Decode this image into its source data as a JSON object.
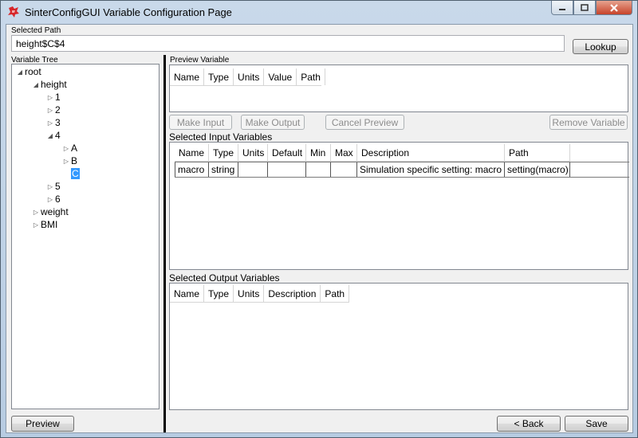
{
  "window": {
    "title": "SinterConfigGUI Variable Configuration Page"
  },
  "selected_path": {
    "label": "Selected Path",
    "value": "height$C$4",
    "lookup_label": "Lookup"
  },
  "tree": {
    "label": "Variable Tree",
    "nodes": [
      "root",
      "height",
      "1",
      "2",
      "3",
      "4",
      "A",
      "B",
      "C",
      "5",
      "6",
      "weight",
      "BMI"
    ]
  },
  "preview": {
    "label": "Preview Variable",
    "columns": [
      "Name",
      "Type",
      "Units",
      "Value",
      "Path"
    ]
  },
  "buttons": {
    "make_input": "Make Input",
    "make_output": "Make Output",
    "cancel_preview": "Cancel Preview",
    "remove_variable": "Remove Variable",
    "preview": "Preview",
    "back": "< Back",
    "save": "Save"
  },
  "inputs": {
    "label": "Selected Input Variables",
    "columns": [
      "Name",
      "Type",
      "Units",
      "Default",
      "Min",
      "Max",
      "Description",
      "Path"
    ],
    "rows": [
      [
        "macro",
        "string",
        "",
        "",
        "",
        "",
        "Simulation specific setting: macro",
        "setting(macro)"
      ]
    ]
  },
  "outputs": {
    "label": "Selected Output Variables",
    "columns": [
      "Name",
      "Type",
      "Units",
      "Description",
      "Path"
    ]
  },
  "colors": {
    "selection": "#3399ff",
    "frame": "#b7cce2",
    "close_button": "#c7432a"
  }
}
